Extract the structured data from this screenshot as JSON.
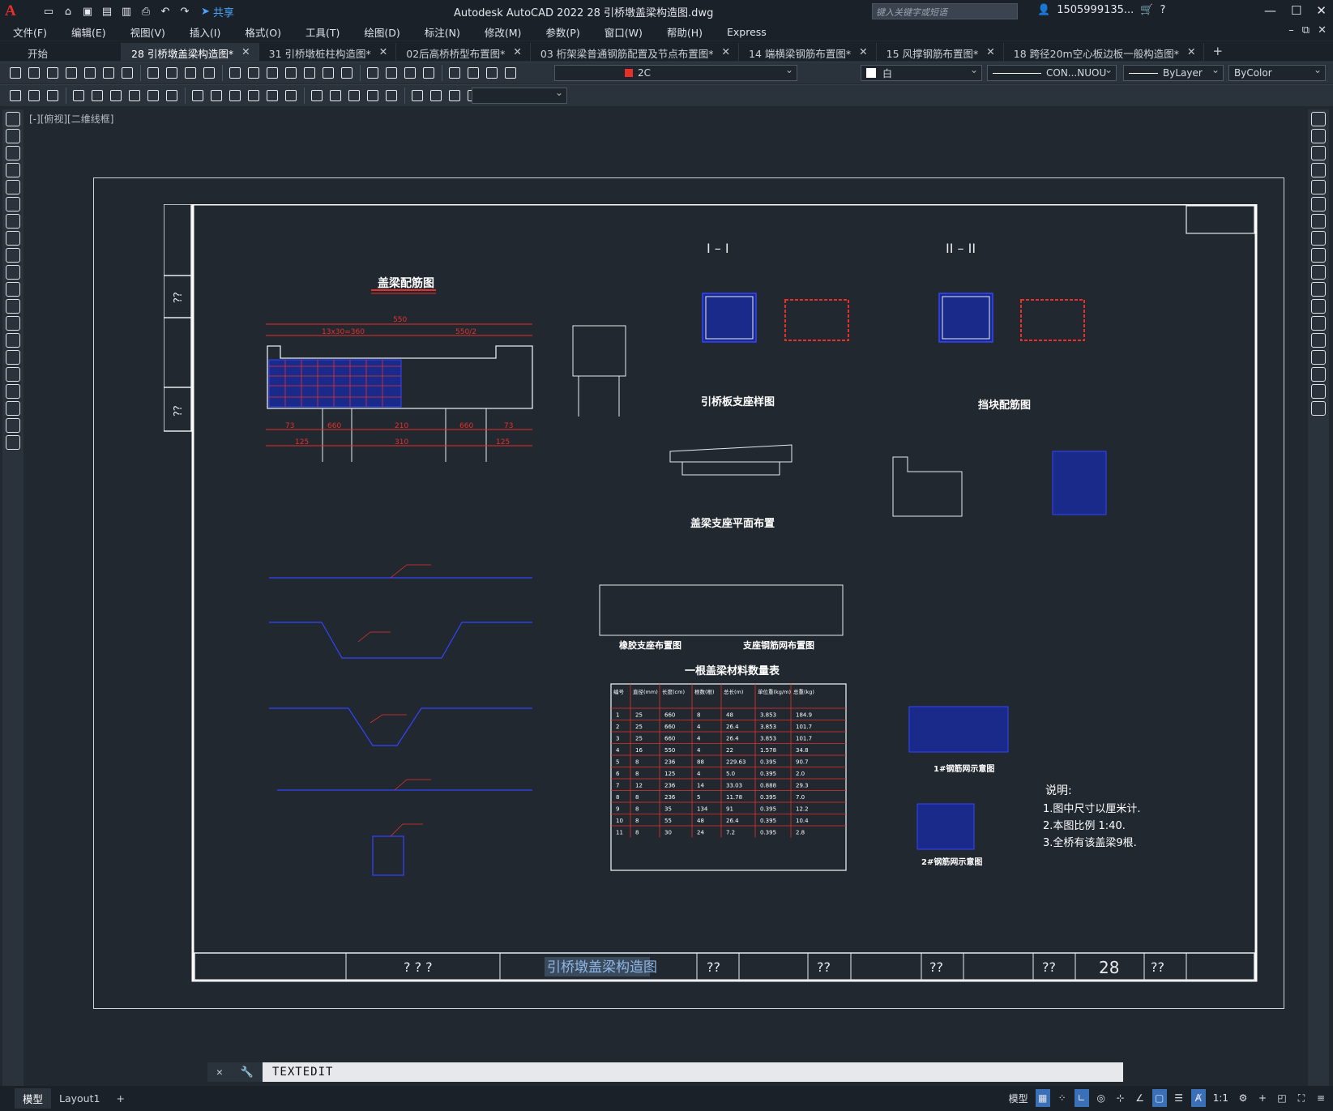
{
  "app": {
    "title": "Autodesk AutoCAD 2022    28 引桥墩盖梁构造图.dwg",
    "logo": "A",
    "share_label": "共享",
    "search_placeholder": "键入关键字或短语",
    "user": "1505999135...",
    "icons": [
      "new-icon",
      "open-icon",
      "save-icon",
      "saveas-icon",
      "plot-icon",
      "undo-icon",
      "redo-icon"
    ]
  },
  "menu": [
    "文件(F)",
    "编辑(E)",
    "视图(V)",
    "插入(I)",
    "格式(O)",
    "工具(T)",
    "绘图(D)",
    "标注(N)",
    "修改(M)",
    "参数(P)",
    "窗口(W)",
    "帮助(H)",
    "Express"
  ],
  "tabs": [
    {
      "label": "开始",
      "active": false
    },
    {
      "label": "28 引桥墩盖梁构造图*",
      "active": true
    },
    {
      "label": "31 引桥墩桩柱构造图*",
      "active": false
    },
    {
      "label": "02后高桥桥型布置图*",
      "active": false
    },
    {
      "label": "03 桁架梁普通钢筋配置及节点布置图*",
      "active": false
    },
    {
      "label": "14 端横梁钢筋布置图*",
      "active": false
    },
    {
      "label": "15 风撑钢筋布置图*",
      "active": false
    },
    {
      "label": "18 跨径20m空心板边板一般构造图*",
      "active": false
    }
  ],
  "toolbar": {
    "layer": "2C",
    "color": "白",
    "linetype": "CON...NUOU",
    "lineweight": "ByLayer",
    "plotstyle": "ByColor"
  },
  "viewport_label": "[-][俯视][二维线框]",
  "drawing": {
    "main_title": "盖梁配筋图",
    "section1": "I – I",
    "section2": "II – II",
    "bearing_pad": "引桥板支座样图",
    "block_rebar": "挡块配筋图",
    "bearing_plan": "盖梁支座平面布置",
    "rubber_bearing": "橡胶支座布置图",
    "mesh_layout": "支座钢筋网布置图",
    "quantity_table": "一根盖梁材料数量表",
    "mesh1": "1#钢筋网示意图",
    "mesh2": "2#钢筋网示意图",
    "notes_title": "说明:",
    "notes": [
      "1.图中尺寸以厘米计.",
      "2.本图比例 1:40.",
      "3.全桥有该盖梁9根."
    ],
    "sheet_title": "引桥墩盖梁构造图",
    "sheet_number": "28",
    "sheet_unknown": "? ? ?",
    "q": "??",
    "dims": {
      "len": "550",
      "span": "13x30=360",
      "half": "550/2",
      "d1": "73",
      "d2": "660",
      "d3": "210",
      "d4": "310",
      "d5": "125"
    },
    "table_headers": [
      "编号",
      "直径(mm)",
      "长度(cm)",
      "根数(根)",
      "总长(m)",
      "单位重(kg/m)",
      "总重(kg)"
    ],
    "table_rows": [
      [
        "1",
        "25",
        "660",
        "8",
        "48",
        "3.853",
        "184.9"
      ],
      [
        "2",
        "25",
        "660",
        "4",
        "26.4",
        "3.853",
        "101.7"
      ],
      [
        "3",
        "25",
        "660",
        "4",
        "26.4",
        "3.853",
        "101.7"
      ],
      [
        "4",
        "16",
        "550",
        "4",
        "22",
        "1.578",
        "34.8"
      ],
      [
        "5",
        "8",
        "236",
        "88",
        "229.63",
        "0.395",
        "90.7"
      ],
      [
        "6",
        "8",
        "125",
        "4",
        "5.0",
        "0.395",
        "2.0"
      ],
      [
        "7",
        "12",
        "236",
        "14",
        "33.03",
        "0.888",
        "29.3"
      ],
      [
        "8",
        "8",
        "236",
        "5",
        "11.78",
        "0.395",
        "7.0"
      ],
      [
        "9",
        "8",
        "35",
        "134",
        "91",
        "0.395",
        "12.2"
      ],
      [
        "10",
        "8",
        "55",
        "48",
        "26.4",
        "0.395",
        "10.4"
      ],
      [
        "11",
        "8",
        "30",
        "24",
        "7.2",
        "0.395",
        "2.8"
      ]
    ]
  }
}
